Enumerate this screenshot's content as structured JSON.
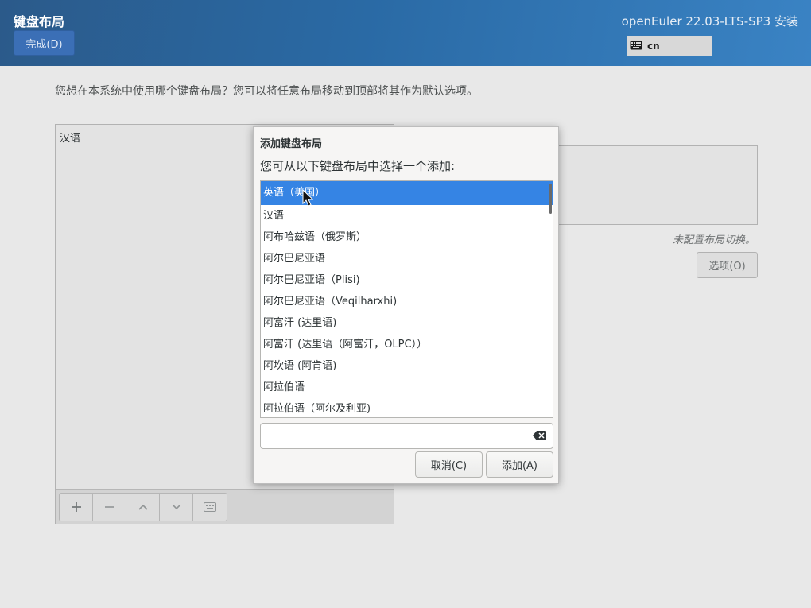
{
  "header": {
    "spoke_title": "键盘布局",
    "done_label": "完成(D)",
    "product_title": "openEuler 22.03-LTS-SP3 安装",
    "keyboard_indicator": {
      "icon": "keyboard-icon",
      "value": "cn"
    }
  },
  "main": {
    "hint": "您想在本系统中使用哪个键盘布局？您可以将任意布局移动到顶部将其作为默认选项。",
    "layouts": [
      "汉语"
    ],
    "toolbar_icons": [
      "plus-icon",
      "minus-icon",
      "up-icon",
      "down-icon",
      "keyboard-preview-icon"
    ],
    "switching_status": "未配置布局切换。",
    "options_label": "选项(O)"
  },
  "dialog": {
    "title": "添加键盘布局",
    "prompt": "您可从以下键盘布局中选择一个添加:",
    "items": [
      "英语（美国）",
      "汉语",
      "阿布哈兹语（俄罗斯）",
      "阿尔巴尼亚语",
      "阿尔巴尼亚语（Plisi)",
      "阿尔巴尼亚语（Veqilharxhi)",
      "阿富汗 (达里语)",
      "阿富汗 (达里语（阿富汗，OLPC））",
      "阿坎语 (阿肯语)",
      "阿拉伯语",
      "阿拉伯语（阿尔及利亚)"
    ],
    "selected_index": 0,
    "search_value": "",
    "cancel_label": "取消(C)",
    "add_label": "添加(A)"
  },
  "colors": {
    "header_start": "#2b5a8a",
    "header_end": "#3a83c4",
    "selection": "#3584e4"
  }
}
